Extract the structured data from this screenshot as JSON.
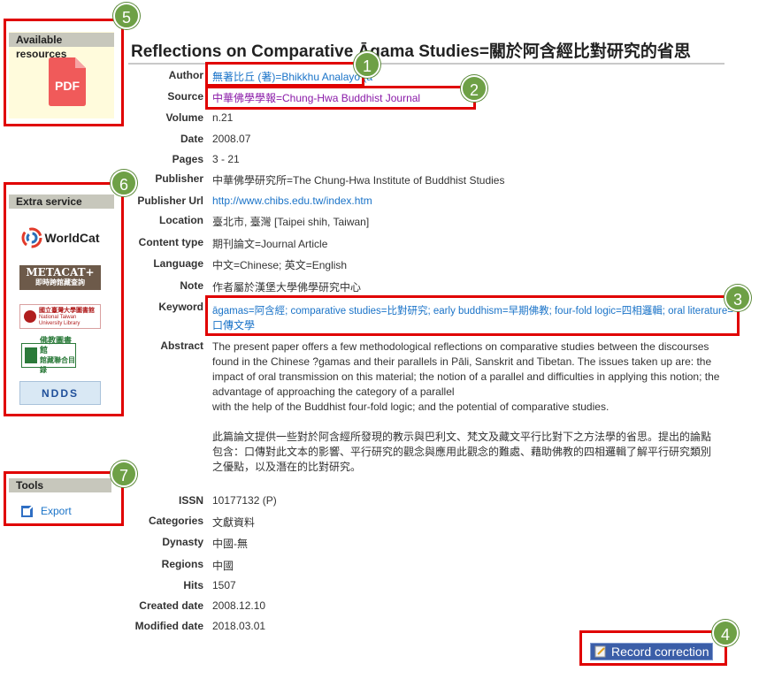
{
  "sidebar": {
    "resources": {
      "title": "Available resources",
      "pdf_label": "PDF"
    },
    "extra": {
      "title": "Extra service",
      "logos": [
        "WorldCat",
        "METACAT+",
        "即時跨館藏查詢",
        "國立臺灣大學圖書館",
        "National Taiwan University Library",
        "佛教圖書館",
        "館藏聯合目錄",
        "NDDS"
      ]
    },
    "tools": {
      "title": "Tools",
      "export_label": "Export"
    }
  },
  "record": {
    "title": "Reflections on Comparative Āgama Studies=關於阿含經比對研究的省思",
    "fields": {
      "author": {
        "label": "Author",
        "value": "無著比丘 (著)=Bhikkhu Analayo (a"
      },
      "source": {
        "label": "Source",
        "value": "中華佛學學報=Chung-Hwa Buddhist Journal"
      },
      "volume": {
        "label": "Volume",
        "value": "n.21"
      },
      "date": {
        "label": "Date",
        "value": "2008.07"
      },
      "pages": {
        "label": "Pages",
        "value": "3 - 21"
      },
      "publisher": {
        "label": "Publisher",
        "value": "中華佛學研究所=The Chung-Hwa Institute of Buddhist Studies"
      },
      "publisher_url": {
        "label": "Publisher Url",
        "value": "http://www.chibs.edu.tw/index.htm"
      },
      "location": {
        "label": "Location",
        "value": "臺北市, 臺灣 [Taipei shih, Taiwan]"
      },
      "content_type": {
        "label": "Content type",
        "value": "期刊論文=Journal Article"
      },
      "language": {
        "label": "Language",
        "value": "中文=Chinese; 英文=English"
      },
      "note": {
        "label": "Note",
        "value": "作者屬於漢堡大學佛學研究中心"
      },
      "keyword": {
        "label": "Keyword",
        "line1": "āgamas=阿含經; comparative studies=比對研究; early buddhism=早期佛教; four-fold logic=四相邏輯; oral literature=",
        "line2": "口傳文學"
      },
      "abstract": {
        "label": "Abstract",
        "en": "The present paper offers a few methodological reflections on comparative studies between the discourses found in the Chinese ?gamas and their parallels in Pāli, Sanskrit and Tibetan. The issues taken up are: the impact of oral transmission on this material; the notion of a parallel and difficulties in applying this notion; the advantage of approaching the category of a parallel",
        "en2": "with the help of the Buddhist four-fold logic; and the potential of comparative studies.",
        "zh": "此篇論文提供一些對於阿含經所發現的教示與巴利文、梵文及藏文平行比對下之方法學的省思。提出的論點包含：口傳對此文本的影響、平行研究的觀念與應用此觀念的難處、藉助佛教的四相邏輯了解平行研究類別之優點，以及潛在的比對研究。"
      },
      "issn": {
        "label": "ISSN",
        "value": "10177132 (P)"
      },
      "categories": {
        "label": "Categories",
        "value": "文獻資料"
      },
      "dynasty": {
        "label": "Dynasty",
        "value": "中國-無"
      },
      "regions": {
        "label": "Regions",
        "value": "中國"
      },
      "hits": {
        "label": "Hits",
        "value": "1507"
      },
      "created": {
        "label": "Created date",
        "value": "2008.12.10"
      },
      "modified": {
        "label": "Modified date",
        "value": "2018.03.01"
      }
    },
    "record_correction_label": "Record correction"
  },
  "callouts": [
    "1",
    "2",
    "3",
    "4",
    "5",
    "6",
    "7"
  ],
  "colors": {
    "callout_red": "#e00000",
    "badge_green": "#6ea046",
    "link_blue": "#1a73c8",
    "pdf_red": "#f05a5a"
  }
}
